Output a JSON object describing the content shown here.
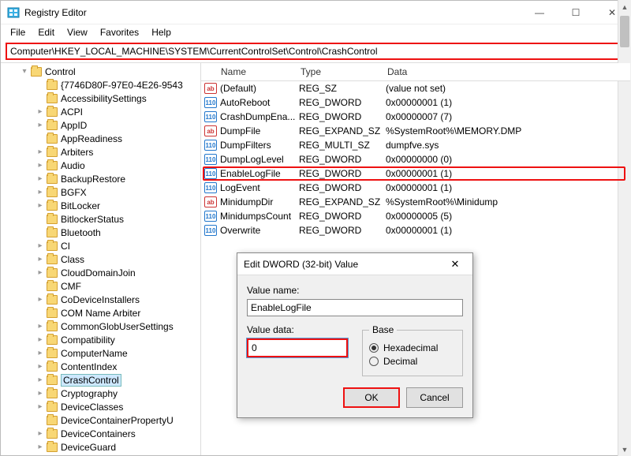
{
  "window": {
    "title": "Registry Editor",
    "controls": {
      "min": "—",
      "max": "☐",
      "close": "✕"
    }
  },
  "menu": [
    "File",
    "Edit",
    "View",
    "Favorites",
    "Help"
  ],
  "address": "Computer\\HKEY_LOCAL_MACHINE\\SYSTEM\\CurrentControlSet\\Control\\CrashControl",
  "tree": {
    "root": "Control",
    "items": [
      "{7746D80F-97E0-4E26-9543",
      "AccessibilitySettings",
      "ACPI",
      "AppID",
      "AppReadiness",
      "Arbiters",
      "Audio",
      "BackupRestore",
      "BGFX",
      "BitLocker",
      "BitlockerStatus",
      "Bluetooth",
      "CI",
      "Class",
      "CloudDomainJoin",
      "CMF",
      "CoDeviceInstallers",
      "COM Name Arbiter",
      "CommonGlobUserSettings",
      "Compatibility",
      "ComputerName",
      "ContentIndex",
      "CrashControl",
      "Cryptography",
      "DeviceClasses",
      "DeviceContainerPropertyU",
      "DeviceContainers",
      "DeviceGuard"
    ],
    "selected": "CrashControl",
    "expandable": [
      "ACPI",
      "AppID",
      "Arbiters",
      "Audio",
      "BackupRestore",
      "BGFX",
      "BitLocker",
      "CI",
      "Class",
      "CloudDomainJoin",
      "CoDeviceInstallers",
      "CommonGlobUserSettings",
      "Compatibility",
      "ComputerName",
      "ContentIndex",
      "CrashControl",
      "Cryptography",
      "DeviceClasses",
      "DeviceContainers",
      "DeviceGuard"
    ]
  },
  "list": {
    "headers": {
      "name": "Name",
      "type": "Type",
      "data": "Data"
    },
    "rows": [
      {
        "icon": "sz",
        "name": "(Default)",
        "type": "REG_SZ",
        "data": "(value not set)"
      },
      {
        "icon": "dw",
        "name": "AutoReboot",
        "type": "REG_DWORD",
        "data": "0x00000001 (1)"
      },
      {
        "icon": "dw",
        "name": "CrashDumpEna...",
        "type": "REG_DWORD",
        "data": "0x00000007 (7)"
      },
      {
        "icon": "sz",
        "name": "DumpFile",
        "type": "REG_EXPAND_SZ",
        "data": "%SystemRoot%\\MEMORY.DMP"
      },
      {
        "icon": "dw",
        "name": "DumpFilters",
        "type": "REG_MULTI_SZ",
        "data": "dumpfve.sys"
      },
      {
        "icon": "dw",
        "name": "DumpLogLevel",
        "type": "REG_DWORD",
        "data": "0x00000000 (0)"
      },
      {
        "icon": "dw",
        "name": "EnableLogFile",
        "type": "REG_DWORD",
        "data": "0x00000001 (1)",
        "highlight": true
      },
      {
        "icon": "dw",
        "name": "LogEvent",
        "type": "REG_DWORD",
        "data": "0x00000001 (1)"
      },
      {
        "icon": "sz",
        "name": "MinidumpDir",
        "type": "REG_EXPAND_SZ",
        "data": "%SystemRoot%\\Minidump"
      },
      {
        "icon": "dw",
        "name": "MinidumpsCount",
        "type": "REG_DWORD",
        "data": "0x00000005 (5)"
      },
      {
        "icon": "dw",
        "name": "Overwrite",
        "type": "REG_DWORD",
        "data": "0x00000001 (1)"
      }
    ]
  },
  "dialog": {
    "title": "Edit DWORD (32-bit) Value",
    "value_name_label": "Value name:",
    "value_name": "EnableLogFile",
    "value_data_label": "Value data:",
    "value_data": "0",
    "base_label": "Base",
    "hex_label": "Hexadecimal",
    "dec_label": "Decimal",
    "base_selected": "hex",
    "ok": "OK",
    "cancel": "Cancel"
  }
}
